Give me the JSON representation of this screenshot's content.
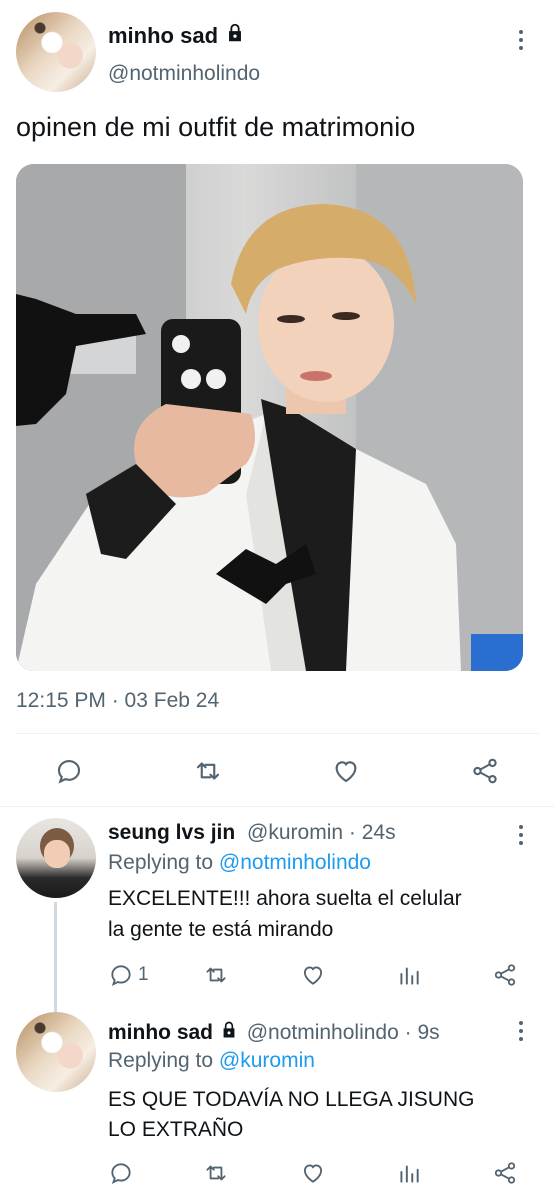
{
  "tweet": {
    "name": "minho sad",
    "handle": "@notminholindo",
    "text": "opinen de mi outfit de matrimonio",
    "timestamp": "12:15 PM · 03 Feb 24",
    "actions": [
      "reply-icon",
      "retweet-icon",
      "like-icon",
      "share-icon"
    ]
  },
  "replies": [
    {
      "name": "seung lvs jin",
      "handle": "@kuromin",
      "time": "· 24s",
      "replying_prefix": "Replying to",
      "replying_to": "@notminholindo",
      "line1": "EXCELENTE!!! ahora suelta el celular",
      "line2": "la gente te está mirando",
      "reply_count": "1"
    },
    {
      "name": "minho sad",
      "handle": "@notminholindo",
      "time": "· 9s",
      "replying_prefix": "Replying to",
      "replying_to": "@kuromin",
      "line1": "ES QUE TODAVÍA NO LLEGA JISUNG",
      "line2": "LO EXTRAÑO"
    }
  ],
  "colors": {
    "text": "#0f1419",
    "muted": "#536471",
    "accent": "#1d9bf0",
    "divider": "#eff3f4"
  }
}
